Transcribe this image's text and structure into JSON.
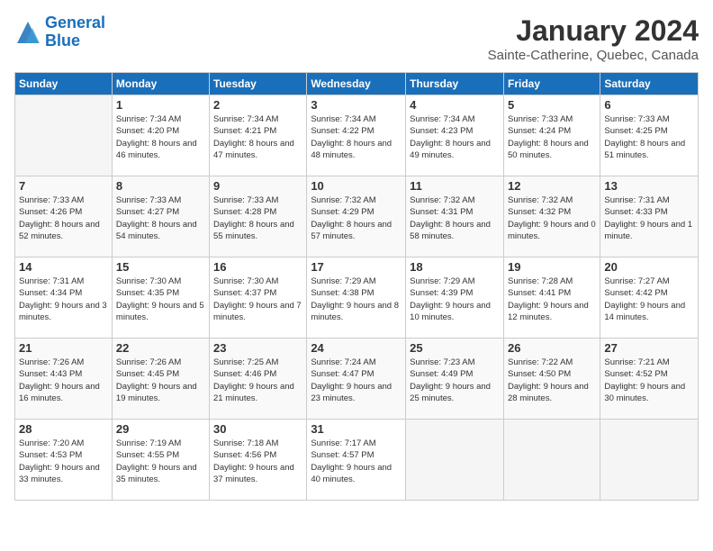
{
  "header": {
    "logo_line1": "General",
    "logo_line2": "Blue",
    "month": "January 2024",
    "location": "Sainte-Catherine, Quebec, Canada"
  },
  "days_of_week": [
    "Sunday",
    "Monday",
    "Tuesday",
    "Wednesday",
    "Thursday",
    "Friday",
    "Saturday"
  ],
  "weeks": [
    [
      {
        "num": "",
        "empty": true
      },
      {
        "num": "1",
        "sunrise": "7:34 AM",
        "sunset": "4:20 PM",
        "daylight": "8 hours and 46 minutes."
      },
      {
        "num": "2",
        "sunrise": "7:34 AM",
        "sunset": "4:21 PM",
        "daylight": "8 hours and 47 minutes."
      },
      {
        "num": "3",
        "sunrise": "7:34 AM",
        "sunset": "4:22 PM",
        "daylight": "8 hours and 48 minutes."
      },
      {
        "num": "4",
        "sunrise": "7:34 AM",
        "sunset": "4:23 PM",
        "daylight": "8 hours and 49 minutes."
      },
      {
        "num": "5",
        "sunrise": "7:33 AM",
        "sunset": "4:24 PM",
        "daylight": "8 hours and 50 minutes."
      },
      {
        "num": "6",
        "sunrise": "7:33 AM",
        "sunset": "4:25 PM",
        "daylight": "8 hours and 51 minutes."
      }
    ],
    [
      {
        "num": "7",
        "sunrise": "7:33 AM",
        "sunset": "4:26 PM",
        "daylight": "8 hours and 52 minutes."
      },
      {
        "num": "8",
        "sunrise": "7:33 AM",
        "sunset": "4:27 PM",
        "daylight": "8 hours and 54 minutes."
      },
      {
        "num": "9",
        "sunrise": "7:33 AM",
        "sunset": "4:28 PM",
        "daylight": "8 hours and 55 minutes."
      },
      {
        "num": "10",
        "sunrise": "7:32 AM",
        "sunset": "4:29 PM",
        "daylight": "8 hours and 57 minutes."
      },
      {
        "num": "11",
        "sunrise": "7:32 AM",
        "sunset": "4:31 PM",
        "daylight": "8 hours and 58 minutes."
      },
      {
        "num": "12",
        "sunrise": "7:32 AM",
        "sunset": "4:32 PM",
        "daylight": "9 hours and 0 minutes."
      },
      {
        "num": "13",
        "sunrise": "7:31 AM",
        "sunset": "4:33 PM",
        "daylight": "9 hours and 1 minute."
      }
    ],
    [
      {
        "num": "14",
        "sunrise": "7:31 AM",
        "sunset": "4:34 PM",
        "daylight": "9 hours and 3 minutes."
      },
      {
        "num": "15",
        "sunrise": "7:30 AM",
        "sunset": "4:35 PM",
        "daylight": "9 hours and 5 minutes."
      },
      {
        "num": "16",
        "sunrise": "7:30 AM",
        "sunset": "4:37 PM",
        "daylight": "9 hours and 7 minutes."
      },
      {
        "num": "17",
        "sunrise": "7:29 AM",
        "sunset": "4:38 PM",
        "daylight": "9 hours and 8 minutes."
      },
      {
        "num": "18",
        "sunrise": "7:29 AM",
        "sunset": "4:39 PM",
        "daylight": "9 hours and 10 minutes."
      },
      {
        "num": "19",
        "sunrise": "7:28 AM",
        "sunset": "4:41 PM",
        "daylight": "9 hours and 12 minutes."
      },
      {
        "num": "20",
        "sunrise": "7:27 AM",
        "sunset": "4:42 PM",
        "daylight": "9 hours and 14 minutes."
      }
    ],
    [
      {
        "num": "21",
        "sunrise": "7:26 AM",
        "sunset": "4:43 PM",
        "daylight": "9 hours and 16 minutes."
      },
      {
        "num": "22",
        "sunrise": "7:26 AM",
        "sunset": "4:45 PM",
        "daylight": "9 hours and 19 minutes."
      },
      {
        "num": "23",
        "sunrise": "7:25 AM",
        "sunset": "4:46 PM",
        "daylight": "9 hours and 21 minutes."
      },
      {
        "num": "24",
        "sunrise": "7:24 AM",
        "sunset": "4:47 PM",
        "daylight": "9 hours and 23 minutes."
      },
      {
        "num": "25",
        "sunrise": "7:23 AM",
        "sunset": "4:49 PM",
        "daylight": "9 hours and 25 minutes."
      },
      {
        "num": "26",
        "sunrise": "7:22 AM",
        "sunset": "4:50 PM",
        "daylight": "9 hours and 28 minutes."
      },
      {
        "num": "27",
        "sunrise": "7:21 AM",
        "sunset": "4:52 PM",
        "daylight": "9 hours and 30 minutes."
      }
    ],
    [
      {
        "num": "28",
        "sunrise": "7:20 AM",
        "sunset": "4:53 PM",
        "daylight": "9 hours and 33 minutes."
      },
      {
        "num": "29",
        "sunrise": "7:19 AM",
        "sunset": "4:55 PM",
        "daylight": "9 hours and 35 minutes."
      },
      {
        "num": "30",
        "sunrise": "7:18 AM",
        "sunset": "4:56 PM",
        "daylight": "9 hours and 37 minutes."
      },
      {
        "num": "31",
        "sunrise": "7:17 AM",
        "sunset": "4:57 PM",
        "daylight": "9 hours and 40 minutes."
      },
      {
        "num": "",
        "empty": true
      },
      {
        "num": "",
        "empty": true
      },
      {
        "num": "",
        "empty": true
      }
    ]
  ]
}
